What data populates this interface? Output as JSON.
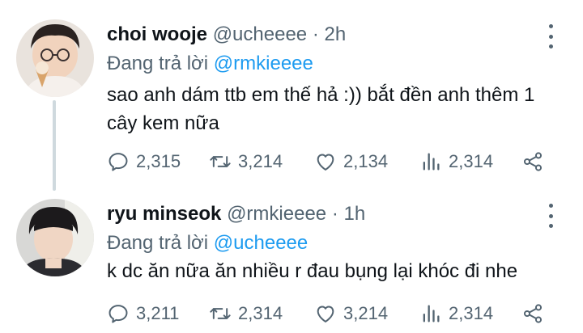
{
  "tweets": [
    {
      "display_name": "choi wooje",
      "handle": "@ucheeee",
      "separator": "·",
      "time": "2h",
      "reply_prefix": "Đang trả lời",
      "reply_to": "@rmkieeee",
      "text": "sao anh dám ttb em thế hả :)) bắt đền anh thêm 1 cây kem nữa",
      "stats": {
        "replies": "2,315",
        "retweets": "3,214",
        "likes": "2,134",
        "views": "2,314"
      },
      "icons": [
        "avatar",
        "more-icon",
        "reply-icon",
        "retweet-icon",
        "like-icon",
        "views-icon",
        "share-icon"
      ]
    },
    {
      "display_name": "ryu minseok",
      "handle": "@rmkieeee",
      "separator": "·",
      "time": "1h",
      "reply_prefix": "Đang trả lời",
      "reply_to": "@ucheeee",
      "text": "k dc ăn nữa ăn nhiều r đau bụng lại khóc đi nhe",
      "stats": {
        "replies": "3,211",
        "retweets": "2,314",
        "likes": "3,214",
        "views": "2,314"
      },
      "icons": [
        "avatar",
        "more-icon",
        "reply-icon",
        "retweet-icon",
        "like-icon",
        "views-icon",
        "share-icon"
      ]
    }
  ],
  "colors": {
    "text": "#0f1419",
    "secondary": "#536471",
    "link": "#1d9bf0",
    "thread_line": "#cfd9de"
  }
}
